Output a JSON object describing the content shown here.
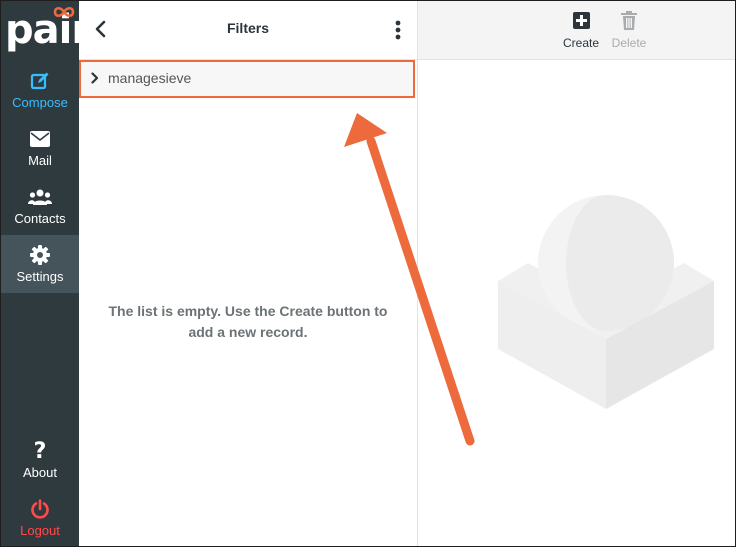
{
  "brand": {
    "logo_text": "pair",
    "logo_accent": "#ec6a3c"
  },
  "sidebar": {
    "items": [
      {
        "label": "Compose",
        "icon": "compose-icon",
        "color": "#37beff"
      },
      {
        "label": "Mail",
        "icon": "mail-icon"
      },
      {
        "label": "Contacts",
        "icon": "contacts-icon"
      },
      {
        "label": "Settings",
        "icon": "gear-icon",
        "active": true
      },
      {
        "label": "About",
        "icon": "question-icon"
      },
      {
        "label": "Logout",
        "icon": "power-icon",
        "color": "#ff4a4a"
      }
    ]
  },
  "list_panel": {
    "title": "Filters",
    "folder": "managesieve",
    "empty_message_line1": "The list is empty. Use the Create button to",
    "empty_message_line2": "add a new record."
  },
  "toolbar": {
    "create_label": "Create",
    "delete_label": "Delete"
  },
  "annotation": {
    "color": "#ec6a3c"
  }
}
